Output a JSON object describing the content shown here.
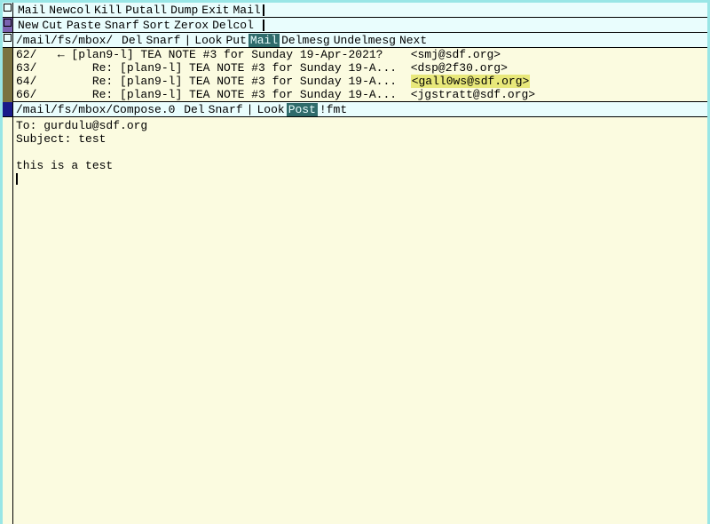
{
  "global_tag": {
    "cmds": [
      "Mail",
      "Newcol",
      "Kill",
      "Putall",
      "Dump",
      "Exit"
    ],
    "extra": "Mail"
  },
  "column_tag": {
    "cmds": [
      "New",
      "Cut",
      "Paste",
      "Snarf",
      "Sort",
      "Zerox",
      "Delcol"
    ]
  },
  "mbox_tag": {
    "path": "/mail/fs/mbox/",
    "cmds_before": [
      "Del",
      "Snarf",
      "|",
      "Look",
      "Put"
    ],
    "sel": "Mail",
    "cmds_after": [
      "Delmesg",
      "Undelmesg",
      "Next"
    ]
  },
  "mbox_messages": [
    {
      "id": "62/",
      "arrow": "←",
      "subject": "[plan9-l] TEA NOTE #3 for Sunday 19-Apr-2021?",
      "from": "<smj@sdf.org>",
      "hl": false
    },
    {
      "id": "63/",
      "arrow": " ",
      "subject": "   Re: [plan9-l] TEA NOTE #3 for Sunday 19-A...",
      "from": "<dsp@2f30.org>",
      "hl": false
    },
    {
      "id": "64/",
      "arrow": " ",
      "subject": "   Re: [plan9-l] TEA NOTE #3 for Sunday 19-A...",
      "from": "<gall0ws@sdf.org>",
      "hl": true
    },
    {
      "id": "66/",
      "arrow": " ",
      "subject": "   Re: [plan9-l] TEA NOTE #3 for Sunday 19-A...",
      "from": "<jgstratt@sdf.org>",
      "hl": false
    }
  ],
  "compose_tag": {
    "path": "/mail/fs/mbox/Compose.0",
    "cmds_before": [
      "Del",
      "Snarf",
      "|",
      "Look"
    ],
    "sel": "Post",
    "cmds_after": [
      "!fmt"
    ]
  },
  "compose_body": {
    "to_label": "To:",
    "to_value": "gurdulu@sdf.org",
    "subject_label": "Subject:",
    "subject_value": "test",
    "content": "this is a test"
  }
}
